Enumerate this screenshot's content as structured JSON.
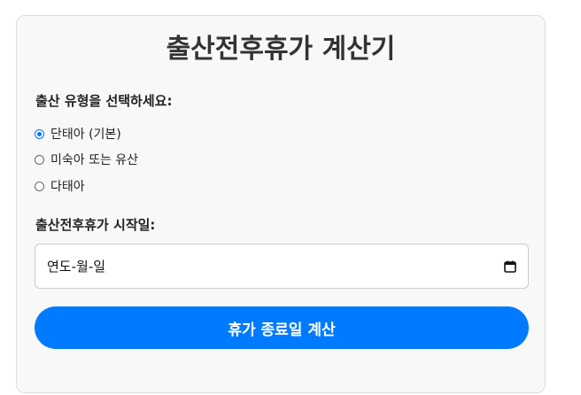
{
  "title": "출산전후휴가 계산기",
  "type_label": "출산 유형을 선택하세요:",
  "options": [
    {
      "label": "단태아 (기본)",
      "checked": true
    },
    {
      "label": "미숙아 또는 유산",
      "checked": false
    },
    {
      "label": "다태아",
      "checked": false
    }
  ],
  "start_label": "출산전후휴가 시작일:",
  "date_placeholder": "연도-월-일",
  "submit_label": "휴가 종료일 계산",
  "colors": {
    "accent": "#007bff",
    "card_bg": "#f8f8f8"
  },
  "icons": {
    "date": "calendar-icon"
  }
}
